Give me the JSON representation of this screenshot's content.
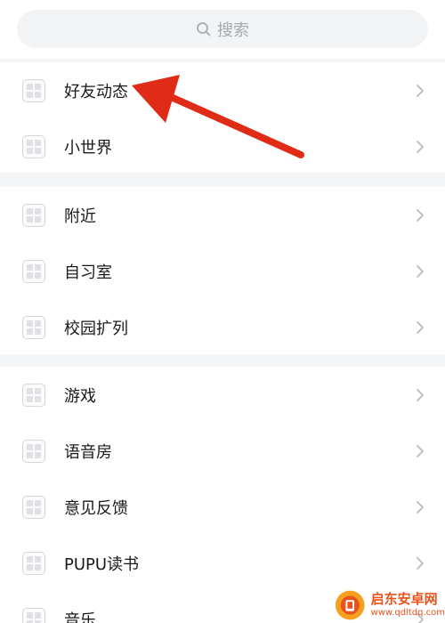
{
  "search": {
    "placeholder": "搜索"
  },
  "sections": [
    {
      "items": [
        {
          "label": "好友动态"
        },
        {
          "label": "小世界"
        }
      ]
    },
    {
      "items": [
        {
          "label": "附近"
        },
        {
          "label": "自习室"
        },
        {
          "label": "校园扩列"
        }
      ]
    },
    {
      "items": [
        {
          "label": "游戏"
        },
        {
          "label": "语音房"
        },
        {
          "label": "意见反馈"
        },
        {
          "label": "PUPU读书"
        },
        {
          "label": "音乐"
        }
      ]
    }
  ],
  "annotation": {
    "color": "#e02b17"
  },
  "watermark": {
    "title": "启东安卓网",
    "url": "www.qdltdq.com"
  },
  "colors": {
    "background": "#ffffff",
    "divider": "#f4f5f7",
    "search_bg": "#f2f3f5",
    "accent": "#e02b17"
  }
}
